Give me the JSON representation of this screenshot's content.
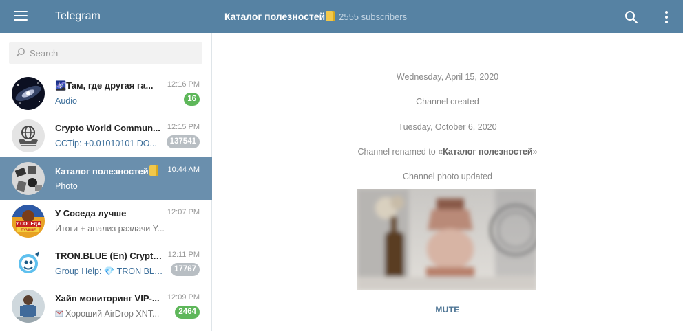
{
  "app": {
    "title": "Telegram"
  },
  "header": {
    "chat_title": "Каталог полезностей",
    "chat_title_emoji": "notebook-emoji",
    "subscribers": "2555 subscribers"
  },
  "search": {
    "placeholder": "Search",
    "value": ""
  },
  "colors": {
    "topbar": "#5682a3",
    "active_chat": "#6a8fad",
    "badge_unmuted": "#5eb75a",
    "badge_muted": "#b8bec3",
    "link_preview": "#3a6d99"
  },
  "chats": [
    {
      "name": "🌌Там, где другая га...",
      "time": "12:16 PM",
      "preview": "Audio",
      "badge": "16",
      "badge_style": "green",
      "preview_style": "link"
    },
    {
      "name": "Crypto World Commun...",
      "time": "12:15 PM",
      "preview": "CCTip: +0.01010101 DO...",
      "badge": "137541",
      "badge_style": "grey",
      "preview_style": "link"
    },
    {
      "name": "Каталог полезностей",
      "time": "10:44 AM",
      "preview": "Photo",
      "badge": "",
      "badge_style": "",
      "preview_style": "link"
    },
    {
      "name": "У Соседа лучше",
      "time": "12:07 PM",
      "preview": "Итоги + анализ раздачи Y...",
      "badge": "",
      "badge_style": "",
      "preview_style": "grey"
    },
    {
      "name": "TRON.BLUE (En) Crypto ...",
      "time": "12:11 PM",
      "preview": "Group Help: 💎 TRON BLU...",
      "badge": "17767",
      "badge_style": "grey",
      "preview_style": "link"
    },
    {
      "name": "Хайп мониторинг VIP-...",
      "time": "12:09 PM",
      "preview": "Хороший AirDrop XNT...",
      "badge": "2464",
      "badge_style": "green",
      "preview_style": "grey"
    }
  ],
  "messages": {
    "date1": "Wednesday, April 15, 2020",
    "created": "Channel created",
    "date2": "Tuesday, October 6, 2020",
    "renamed_prefix": "Channel renamed to «",
    "renamed_name": "Каталог полезностей",
    "renamed_suffix": "»",
    "photo_updated": "Channel photo updated"
  },
  "footer": {
    "mute_label": "MUTE"
  }
}
